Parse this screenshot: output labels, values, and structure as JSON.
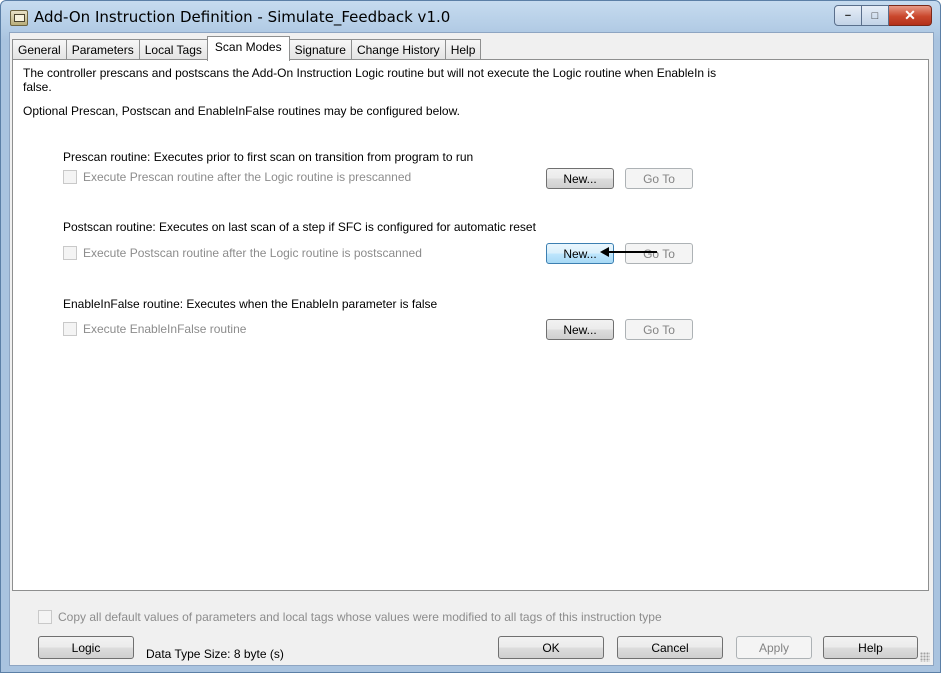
{
  "window": {
    "title": "Add-On Instruction Definition - Simulate_Feedback v1.0",
    "controls": {
      "minimize": "−",
      "maximize": "□",
      "close": "✕"
    }
  },
  "tabs": [
    "General",
    "Parameters",
    "Local Tags",
    "Scan Modes",
    "Signature",
    "Change History",
    "Help"
  ],
  "active_tab": "Scan Modes",
  "scan_modes": {
    "description": "The controller prescans and postscans the Add-On Instruction Logic routine but will not execute the Logic routine when EnableIn is false.",
    "optional_note": "Optional Prescan, Postscan and EnableInFalse routines may be configured below.",
    "prescan": {
      "label": "Prescan routine: Executes prior to first scan on transition from program to run",
      "checkbox": "Execute Prescan routine after the Logic routine is prescanned",
      "new_button": "New...",
      "goto_button": "Go To"
    },
    "postscan": {
      "label": "Postscan routine: Executes on last scan of a step if SFC is configured for automatic reset",
      "checkbox": "Execute Postscan routine after the Logic routine is postscanned",
      "new_button": "New...",
      "goto_button": "Go To"
    },
    "enableinfalse": {
      "label": "EnableInFalse routine: Executes when the EnableIn parameter is false",
      "checkbox": "Execute EnableInFalse routine",
      "new_button": "New...",
      "goto_button": "Go To"
    }
  },
  "footer": {
    "copy_checkbox": "Copy all default values of parameters and local tags whose values were modified to all tags of this instruction type",
    "logic_button": "Logic",
    "data_type_size": "Data Type Size: 8 byte (s)",
    "ok": "OK",
    "cancel": "Cancel",
    "apply": "Apply",
    "help": "Help"
  }
}
